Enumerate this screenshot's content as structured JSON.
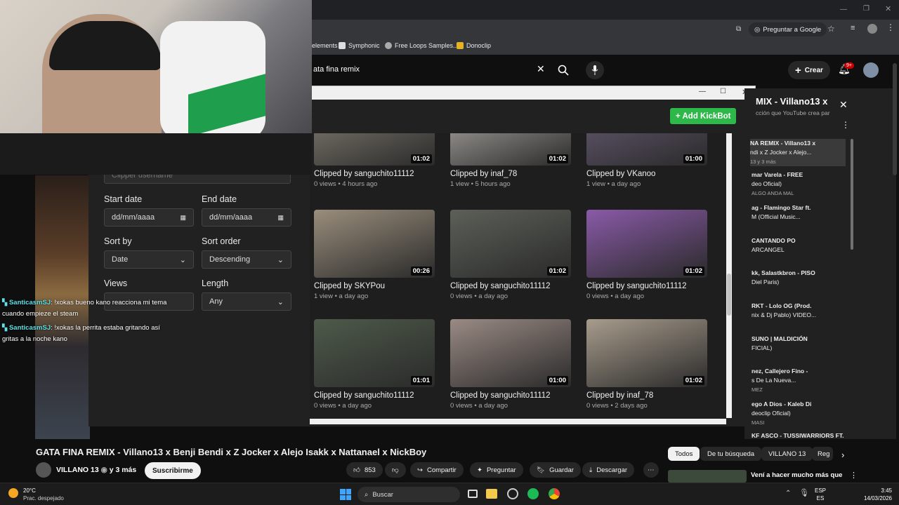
{
  "browser": {
    "ask_google": "Preguntar a Google",
    "bookmarks": [
      {
        "label": "elements",
        "color": "#555"
      },
      {
        "label": "Symphonic",
        "color": "#ddd"
      },
      {
        "label": "Free Loops Samples...",
        "color": "#aaa"
      },
      {
        "label": "Donoclip",
        "color": "#e6b325"
      }
    ]
  },
  "youtube": {
    "search_value": "ata fina remix",
    "create_label": "Crear",
    "notif_count": "9+"
  },
  "app": {
    "add_kickbot": "+ Add KickBot",
    "filters": {
      "clipper_placeholder": "Clipper username",
      "start_date_label": "Start date",
      "end_date_label": "End date",
      "date_placeholder": "dd/mm/aaaa",
      "sort_by_label": "Sort by",
      "sort_by_value": "Date",
      "sort_order_label": "Sort order",
      "sort_order_value": "Descending",
      "views_label": "Views",
      "length_label": "Length",
      "length_value": "Any"
    },
    "clips": [
      {
        "title": "Clipped by sanguchito11112",
        "meta": "0 views • 4 hours ago",
        "duration": "01:02",
        "bg": "#8a8478"
      },
      {
        "title": "Clipped by inaf_78",
        "meta": "1 view • 5 hours ago",
        "duration": "01:02",
        "bg": "#b8b4ae"
      },
      {
        "title": "Clipped by VKanoo",
        "meta": "1 view • a day ago",
        "duration": "01:00",
        "bg": "#6b5e78"
      },
      {
        "title": "Clipped by SKYPou",
        "meta": "1 view • a day ago",
        "duration": "00:26",
        "bg": "#9a8e7c"
      },
      {
        "title": "Clipped by sanguchito11112",
        "meta": "0 views • a day ago",
        "duration": "01:02",
        "bg": "#5c6058"
      },
      {
        "title": "Clipped by sanguchito11112",
        "meta": "0 views • a day ago",
        "duration": "01:02",
        "bg": "#8a5aa8"
      },
      {
        "title": "Clipped by sanguchito11112",
        "meta": "0 views • a day ago",
        "duration": "01:01",
        "bg": "#4e5a4a"
      },
      {
        "title": "Clipped by sanguchito11112",
        "meta": "0 views • a day ago",
        "duration": "01:00",
        "bg": "#9a8a84"
      },
      {
        "title": "Clipped by inaf_78",
        "meta": "0 views • 2 days ago",
        "duration": "01:02",
        "bg": "#a89c8c"
      }
    ]
  },
  "chat": [
    {
      "user": "SanticasmSJ",
      "msg": ": !xokas bueno kano reaccionа mi tema",
      "cont": "cuando empieze el steam"
    },
    {
      "user": "SanticasmSJ",
      "msg": ": !xokas la perrita estaba gritando así",
      "cont": "gritas a la noche kano"
    }
  ],
  "playlist": {
    "title": "MIX - Villano13 x",
    "subtitle": "cción que YouTube crea par",
    "items": [
      [
        "NA REMIX - Villano13 x",
        "ndi x Z Jocker x Alejo...",
        "13 y 3 más"
      ],
      [
        "mar Varela - FREE",
        "deo Oficial)",
        "ALGO ANDA MAL"
      ],
      [
        "ag - Flamingo Star ft.",
        "M (Official Music..."
      ],
      [
        "CANTANDO PO",
        "ARCANGEL"
      ],
      [
        "kk, Salastkbron - PISO",
        "Diel Paris)"
      ],
      [
        "RKT - Lolo OG (Prod.",
        "nix & Dj Pablo) VIDEO..."
      ],
      [
        "SUNO | MALDICIÓN",
        "FICIAL)"
      ],
      [
        "nez, Callejero Fino -",
        "s De La Nueva...",
        "MEZ"
      ],
      [
        "ego A Dios - Kaleb Di",
        "deoclip Oficial)",
        "MASI"
      ],
      [
        "KF ASCO - TUSSIWARRIORS FT."
      ]
    ]
  },
  "video": {
    "title": "GATA FINA REMIX - Villano13 x Benji Bendi x Z Jocker x Alejo Isakk x Nattanael x NickBoy",
    "channel": "VILLANO 13",
    "channel_extra": "y 3 más",
    "subscribe": "Suscribirme",
    "likes": "853",
    "share": "Compartir",
    "ask": "Preguntar",
    "save": "Guardar",
    "download": "Descargar",
    "chips": [
      "Todos",
      "De tu búsqueda",
      "VILLANO 13",
      "Reg"
    ],
    "next_title": "Vení a hacer mucho más que"
  },
  "taskbar": {
    "temp": "20°C",
    "weather": "Prac. despejado",
    "search": "Buscar",
    "lang1": "ESP",
    "lang2": "ES",
    "time": "3:45",
    "date": "14/03/2026"
  },
  "colors": {
    "accent_green": "#2fb84a",
    "yt_red": "#ff0000"
  }
}
